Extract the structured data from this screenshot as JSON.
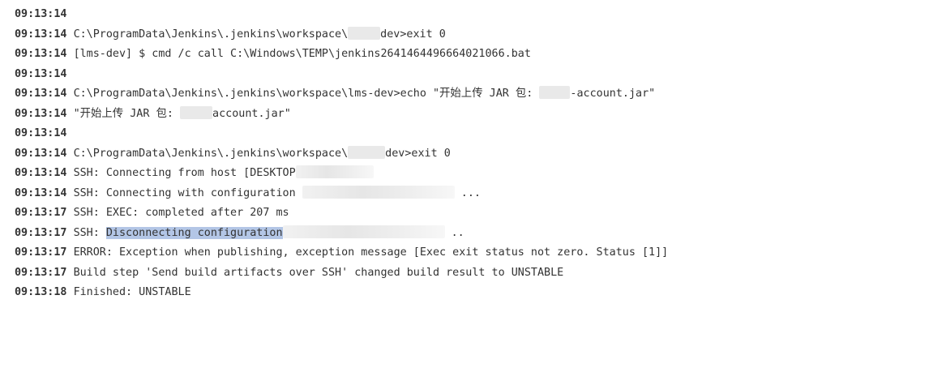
{
  "console": {
    "lines": [
      {
        "ts": "09:13:14",
        "text": ""
      },
      {
        "ts": "09:13:14",
        "a": "C:\\ProgramData\\Jenkins\\.jenkins\\workspace\\",
        "b": "dev>exit 0"
      },
      {
        "ts": "09:13:14",
        "text": "[lms-dev] $ cmd /c call C:\\Windows\\TEMP\\jenkins2641464496664021066.bat"
      },
      {
        "ts": "09:13:14",
        "text": ""
      },
      {
        "ts": "09:13:14",
        "a": "C:\\ProgramData\\Jenkins\\.jenkins\\workspace\\lms-dev>echo \"开始上传 JAR 包: ",
        "b": "-account.jar\""
      },
      {
        "ts": "09:13:14",
        "a": "\"开始上传 JAR 包: ",
        "b": "account.jar\""
      },
      {
        "ts": "09:13:14",
        "text": ""
      },
      {
        "ts": "09:13:14",
        "a": "C:\\ProgramData\\Jenkins\\.jenkins\\workspace\\",
        "b": "dev>exit 0"
      },
      {
        "ts": "09:13:14",
        "a": "SSH: Connecting from host [DESKTOP"
      },
      {
        "ts": "09:13:14",
        "a": "SSH: Connecting with configuration ",
        "b": " ..."
      },
      {
        "ts": "09:13:17",
        "text": "SSH: EXEC: completed after 207 ms"
      },
      {
        "ts": "09:13:17",
        "a": "SSH: ",
        "sel": "Disconnecting configuration",
        "b": " .."
      },
      {
        "ts": "09:13:17",
        "text": "ERROR: Exception when publishing, exception message [Exec exit status not zero. Status [1]]"
      },
      {
        "ts": "09:13:17",
        "text": "Build step 'Send build artifacts over SSH' changed build result to UNSTABLE"
      },
      {
        "ts": "09:13:18",
        "text": "Finished: UNSTABLE"
      }
    ]
  }
}
